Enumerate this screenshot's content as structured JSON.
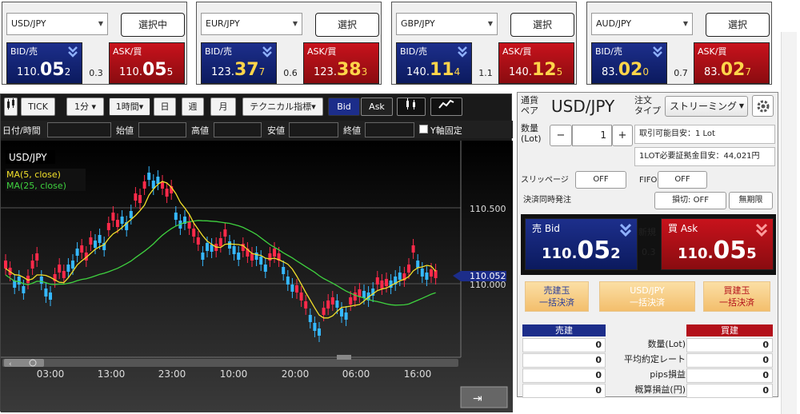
{
  "rate_panels": [
    {
      "pair": "USD/JPY",
      "button": "選択中",
      "bid_label": "BID/売",
      "ask_label": "ASK/買",
      "bid": {
        "small": "110.",
        "big": "05",
        "last": "2"
      },
      "ask": {
        "small": "110.",
        "big": "05",
        "last": "5"
      },
      "spread": "0.3"
    },
    {
      "pair": "EUR/JPY",
      "button": "選択",
      "bid_label": "BID/売",
      "ask_label": "ASK/買",
      "bid": {
        "small": "123.",
        "big": "37",
        "last": "7"
      },
      "ask": {
        "small": "123.",
        "big": "38",
        "last": "3"
      },
      "spread": "0.6"
    },
    {
      "pair": "GBP/JPY",
      "button": "選択",
      "bid_label": "BID/売",
      "ask_label": "ASK/買",
      "bid": {
        "small": "140.",
        "big": "11",
        "last": "4"
      },
      "ask": {
        "small": "140.",
        "big": "12",
        "last": "5"
      },
      "spread": "1.1"
    },
    {
      "pair": "AUD/JPY",
      "button": "選択",
      "bid_label": "BID/売",
      "ask_label": "ASK/買",
      "bid": {
        "small": "83.",
        "big": "02",
        "last": "0"
      },
      "ask": {
        "small": "83.",
        "big": "02",
        "last": "7"
      },
      "spread": "0.7"
    }
  ],
  "toolbar": {
    "tick": "TICK",
    "min1": "1分 ▾",
    "hour1": "1時間▾",
    "day": "日",
    "week": "週",
    "month": "月",
    "technical": "テクニカル指標▾",
    "bid": "Bid",
    "ask": "Ask"
  },
  "date_row": {
    "datetime": "日付/時間",
    "open": "始値",
    "high": "高値",
    "low": "安値",
    "close": "終値",
    "yfix": "Y軸固定"
  },
  "chart": {
    "symbol": "USD/JPY",
    "ma5": "MA(5, close)",
    "ma25": "MA(25, close)",
    "current_price": "110.052",
    "y_ticks": [
      "110.500",
      "110.000"
    ],
    "x_ticks": [
      "03:00",
      "13:00",
      "23:00",
      "10:00",
      "20:00",
      "06:00",
      "16:00"
    ],
    "colors": {
      "up": "#ff2a4a",
      "down": "#35b8ff",
      "ma5": "#f2e02a",
      "ma25": "#3fd23f"
    }
  },
  "order": {
    "pair_label": "通貨\nペア",
    "pair": "USD/JPY",
    "order_type_label": "注文\nタイプ",
    "order_type": "ストリーミング",
    "qty_label": "数量\n(Lot)",
    "qty_minus": "−",
    "qty_value": "1",
    "qty_plus": "+",
    "tradable": "取引可能目安：1 Lot",
    "margin": "1LOT必要証拠金目安：44,021円",
    "slippage_label": "スリッページ",
    "slippage": "OFF",
    "fifo_label": "FIFO",
    "fifo": "OFF",
    "settle_label": "決済同時発注",
    "stoploss": "損切: OFF",
    "unlimited": "無期限",
    "bid_label": "売 Bid",
    "ask_label": "買 Ask",
    "new_label": "新規",
    "spread": "0.3",
    "bid": {
      "small": "110.",
      "big": "05",
      "last": "2"
    },
    "ask": {
      "small": "110.",
      "big": "05",
      "last": "5"
    },
    "settle_sell": [
      "売建玉",
      "一括決済"
    ],
    "settle_pair": [
      "USD/JPY",
      "一括決済"
    ],
    "settle_buy": [
      "買建玉",
      "一括決済"
    ],
    "sell_header": "売建",
    "buy_header": "買建",
    "rows": [
      {
        "label": "数量(Lot)",
        "sell": "0",
        "buy": "0"
      },
      {
        "label": "平均約定レート",
        "sell": "0",
        "buy": "0"
      },
      {
        "label": "pips損益",
        "sell": "0",
        "buy": "0"
      },
      {
        "label": "概算損益(円)",
        "sell": "0",
        "buy": "0"
      }
    ]
  }
}
